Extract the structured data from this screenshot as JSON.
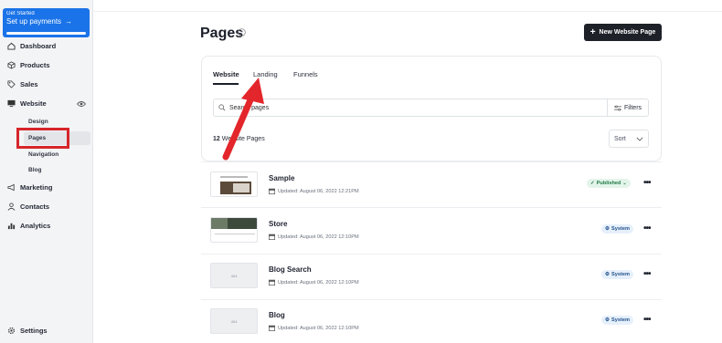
{
  "promo": {
    "small_text": "Get Started",
    "main_text": "Set up payments"
  },
  "sidebar": {
    "items": [
      {
        "label": "Dashboard",
        "icon": "home-icon"
      },
      {
        "label": "Products",
        "icon": "box-icon"
      },
      {
        "label": "Sales",
        "icon": "tag-icon"
      },
      {
        "label": "Website",
        "icon": "monitor-icon"
      },
      {
        "label": "Marketing",
        "icon": "megaphone-icon"
      },
      {
        "label": "Contacts",
        "icon": "person-icon"
      },
      {
        "label": "Analytics",
        "icon": "bar-chart-icon"
      }
    ],
    "website_sub": [
      "Design",
      "Pages",
      "Navigation",
      "Blog"
    ],
    "settings_label": "Settings"
  },
  "header": {
    "title": "Pages",
    "new_button": "New Website Page"
  },
  "tabs": [
    "Website",
    "Landing",
    "Funnels"
  ],
  "search": {
    "value": "Search pages"
  },
  "filters_label": "Filters",
  "count": {
    "number": "12",
    "text": "Website Pages"
  },
  "sort_label": "Sort",
  "pages": [
    {
      "title": "Sample",
      "updated": "Updated: August 06, 2022 12:21PM",
      "status": "Published",
      "thumb_text": ""
    },
    {
      "title": "Store",
      "updated": "Updated: August 06, 2022 12:10PM",
      "status": "System",
      "thumb_text": ""
    },
    {
      "title": "Blog Search",
      "updated": "Updated: August 06, 2022 12:10PM",
      "status": "System",
      "thumb_text": "404"
    },
    {
      "title": "Blog",
      "updated": "Updated: August 06, 2022 12:10PM",
      "status": "System",
      "thumb_text": "404"
    }
  ],
  "colors": {
    "accent": "#1a73e8",
    "annotation": "#e3262b",
    "highlight_box": "#d6262b",
    "dark_button": "#1e2128"
  }
}
